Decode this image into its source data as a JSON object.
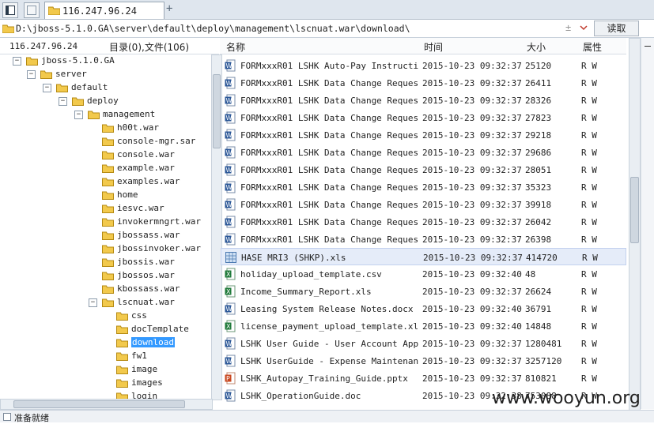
{
  "tabbar": {
    "tab_title": "116.247.96.24",
    "add_tab_symbol": "+"
  },
  "address": {
    "path": "D:\\jboss-5.1.0.GA\\server\\default\\deploy\\management\\lscnuat.war\\download\\",
    "read_button": "读取",
    "refresh_symbol": "±"
  },
  "left_header": {
    "host": "116.247.96.24",
    "summary": "目录(0),文件(106)"
  },
  "tree": [
    {
      "label": "jboss-5.1.0.GA",
      "toggle": "-"
    },
    {
      "label": "server",
      "toggle": "-"
    },
    {
      "label": "default",
      "toggle": "-"
    },
    {
      "label": "deploy",
      "toggle": "-"
    },
    {
      "label": "management",
      "toggle": "-"
    },
    {
      "label": "h00t.war",
      "toggle": ""
    },
    {
      "label": "console-mgr.sar",
      "toggle": ""
    },
    {
      "label": "console.war",
      "toggle": ""
    },
    {
      "label": "example.war",
      "toggle": ""
    },
    {
      "label": "examples.war",
      "toggle": ""
    },
    {
      "label": "home",
      "toggle": ""
    },
    {
      "label": "iesvc.war",
      "toggle": ""
    },
    {
      "label": "invokermngrt.war",
      "toggle": ""
    },
    {
      "label": "jbossass.war",
      "toggle": ""
    },
    {
      "label": "jbossinvoker.war",
      "toggle": ""
    },
    {
      "label": "jbossis.war",
      "toggle": ""
    },
    {
      "label": "jbossos.war",
      "toggle": ""
    },
    {
      "label": "kbossass.war",
      "toggle": ""
    },
    {
      "label": "lscnuat.war",
      "toggle": "-"
    },
    {
      "label": "css",
      "toggle": ""
    },
    {
      "label": "docTemplate",
      "toggle": ""
    },
    {
      "label": "download",
      "toggle": ""
    },
    {
      "label": "fw1",
      "toggle": ""
    },
    {
      "label": "image",
      "toggle": ""
    },
    {
      "label": "images",
      "toggle": ""
    },
    {
      "label": "login",
      "toggle": ""
    }
  ],
  "columns": {
    "name": "名称",
    "time": "时间",
    "size": "大小",
    "attr": "属性"
  },
  "files": [
    {
      "name": "FORMxxxR01 LSHK Auto-Pay Instructio...",
      "time": "2015-10-23 09:32:37",
      "size": "25120",
      "attr": "R W",
      "icon": "word"
    },
    {
      "name": "FORMxxxR01 LSHK Data Change Request...",
      "time": "2015-10-23 09:32:37",
      "size": "26411",
      "attr": "R W",
      "icon": "word"
    },
    {
      "name": "FORMxxxR01 LSHK Data Change Request...",
      "time": "2015-10-23 09:32:37",
      "size": "28326",
      "attr": "R W",
      "icon": "word"
    },
    {
      "name": "FORMxxxR01 LSHK Data Change Request...",
      "time": "2015-10-23 09:32:37",
      "size": "27823",
      "attr": "R W",
      "icon": "word"
    },
    {
      "name": "FORMxxxR01 LSHK Data Change Request...",
      "time": "2015-10-23 09:32:37",
      "size": "29218",
      "attr": "R W",
      "icon": "word"
    },
    {
      "name": "FORMxxxR01 LSHK Data Change Request...",
      "time": "2015-10-23 09:32:37",
      "size": "29686",
      "attr": "R W",
      "icon": "word"
    },
    {
      "name": "FORMxxxR01 LSHK Data Change Request...",
      "time": "2015-10-23 09:32:37",
      "size": "28051",
      "attr": "R W",
      "icon": "word"
    },
    {
      "name": "FORMxxxR01 LSHK Data Change Request...",
      "time": "2015-10-23 09:32:37",
      "size": "35323",
      "attr": "R W",
      "icon": "word"
    },
    {
      "name": "FORMxxxR01 LSHK Data Change Request...",
      "time": "2015-10-23 09:32:37",
      "size": "39918",
      "attr": "R W",
      "icon": "word"
    },
    {
      "name": "FORMxxxR01 LSHK Data Change Request...",
      "time": "2015-10-23 09:32:37",
      "size": "26042",
      "attr": "R W",
      "icon": "word"
    },
    {
      "name": "FORMxxxR01 LSHK Data Change Request...",
      "time": "2015-10-23 09:32:37",
      "size": "26398",
      "attr": "R W",
      "icon": "word"
    },
    {
      "name": "HASE MRI3 (SHKP).xls",
      "time": "2015-10-23 09:32:37",
      "size": "414720",
      "attr": "R W",
      "icon": "xls-blue",
      "selected": true
    },
    {
      "name": "holiday_upload_template.csv",
      "time": "2015-10-23 09:32:40",
      "size": "48",
      "attr": "R W",
      "icon": "excel"
    },
    {
      "name": "Income_Summary_Report.xls",
      "time": "2015-10-23 09:32:37",
      "size": "26624",
      "attr": "R W",
      "icon": "excel"
    },
    {
      "name": "Leasing System Release Notes.docx",
      "time": "2015-10-23 09:32:40",
      "size": "36791",
      "attr": "R W",
      "icon": "word"
    },
    {
      "name": "license_payment_upload_template.xls",
      "time": "2015-10-23 09:32:40",
      "size": "14848",
      "attr": "R W",
      "icon": "excel"
    },
    {
      "name": "LSHK User Guide - User Account Appl...",
      "time": "2015-10-23 09:32:37",
      "size": "1280481",
      "attr": "R W",
      "icon": "word"
    },
    {
      "name": "LSHK UserGuide - Expense Maintenanc...",
      "time": "2015-10-23 09:32:37",
      "size": "3257120",
      "attr": "R W",
      "icon": "word"
    },
    {
      "name": "LSHK_Autopay_Training_Guide.pptx",
      "time": "2015-10-23 09:32:37",
      "size": "810821",
      "attr": "R W",
      "icon": "ppt"
    },
    {
      "name": "LSHK_OperationGuide.doc",
      "time": "2015-10-23 09:32:38",
      "size": "753088",
      "attr": "R W",
      "icon": "word"
    }
  ],
  "status": {
    "text": "准备就绪"
  },
  "watermark": "www.wooyun.org",
  "colors": {
    "word": "#2b5797",
    "excel": "#1f7a3a",
    "ppt": "#c9471f",
    "folder": "#f2c94c",
    "selection": "#3399ff"
  }
}
